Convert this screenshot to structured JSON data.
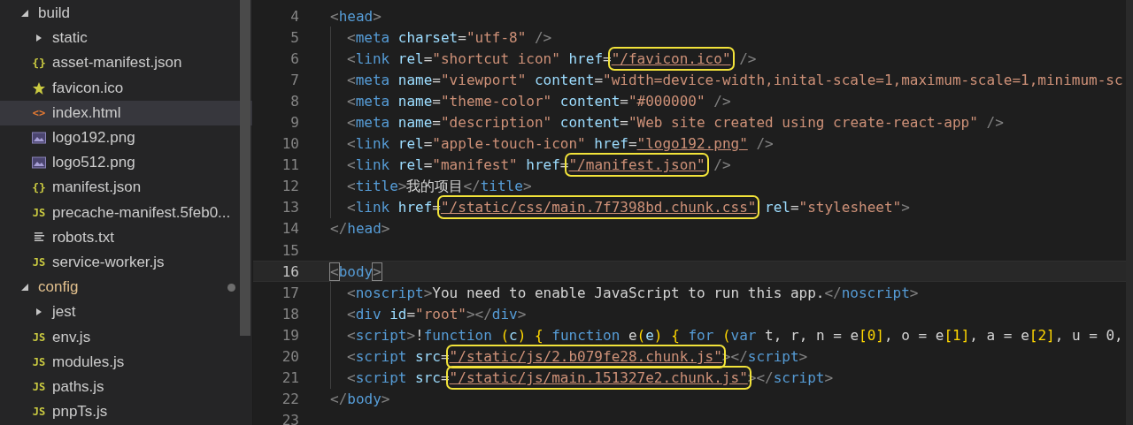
{
  "sidebar": {
    "items": [
      {
        "kind": "folder",
        "label": "build",
        "expanded": true,
        "modified": false,
        "selected": false,
        "children": [
          {
            "kind": "folder",
            "label": "static",
            "expanded": false,
            "modified": false,
            "selected": false
          },
          {
            "kind": "json",
            "glyph": "{}",
            "label": "asset-manifest.json",
            "selected": false
          },
          {
            "kind": "star",
            "label": "favicon.ico",
            "selected": false
          },
          {
            "kind": "html",
            "glyph": "<>",
            "label": "index.html",
            "selected": true
          },
          {
            "kind": "image",
            "label": "logo192.png",
            "selected": false
          },
          {
            "kind": "image",
            "label": "logo512.png",
            "selected": false
          },
          {
            "kind": "json",
            "glyph": "{}",
            "label": "manifest.json",
            "selected": false
          },
          {
            "kind": "js",
            "glyph": "JS",
            "label": "precache-manifest.5feb0...",
            "selected": false
          },
          {
            "kind": "text",
            "label": "robots.txt",
            "selected": false
          },
          {
            "kind": "js",
            "glyph": "JS",
            "label": "service-worker.js",
            "selected": false
          }
        ]
      },
      {
        "kind": "folder",
        "label": "config",
        "expanded": true,
        "modified": true,
        "selected": false,
        "children": [
          {
            "kind": "folder",
            "label": "jest",
            "expanded": false,
            "modified": false,
            "selected": false
          },
          {
            "kind": "js",
            "glyph": "JS",
            "label": "env.js",
            "selected": false
          },
          {
            "kind": "js",
            "glyph": "JS",
            "label": "modules.js",
            "selected": false
          },
          {
            "kind": "js",
            "glyph": "JS",
            "label": "paths.js",
            "selected": false
          },
          {
            "kind": "js",
            "glyph": "JS",
            "label": "pnpTs.js",
            "selected": false
          }
        ]
      }
    ]
  },
  "editor": {
    "lines": [
      {
        "number": "4",
        "current": false,
        "tokens": [
          {
            "kind": "p",
            "text": "<"
          },
          {
            "kind": "tag",
            "text": "head"
          },
          {
            "kind": "p",
            "text": ">"
          }
        ],
        "children": [
          {
            "number": "5",
            "current": false,
            "tokens": [
              {
                "kind": "p",
                "text": "<"
              },
              {
                "kind": "tag",
                "text": "meta"
              },
              {
                "kind": "attr",
                "text": " charset"
              },
              {
                "kind": "txt",
                "text": "="
              },
              {
                "kind": "str",
                "text": "\"utf-8\""
              },
              {
                "kind": "p",
                "text": " />"
              }
            ]
          },
          {
            "number": "6",
            "current": false,
            "tokens": [
              {
                "kind": "p",
                "text": "<"
              },
              {
                "kind": "tag",
                "text": "link"
              },
              {
                "kind": "attr",
                "text": " rel"
              },
              {
                "kind": "txt",
                "text": "="
              },
              {
                "kind": "str",
                "text": "\"shortcut icon\""
              },
              {
                "kind": "attr",
                "text": " href"
              },
              {
                "kind": "txt",
                "text": "="
              },
              {
                "kind": "str",
                "text": "\"/favicon.ico\"",
                "boxed": true,
                "link": true
              },
              {
                "kind": "p",
                "text": " />"
              }
            ]
          },
          {
            "number": "7",
            "current": false,
            "tokens": [
              {
                "kind": "p",
                "text": "<"
              },
              {
                "kind": "tag",
                "text": "meta"
              },
              {
                "kind": "attr",
                "text": " name"
              },
              {
                "kind": "txt",
                "text": "="
              },
              {
                "kind": "str",
                "text": "\"viewport\""
              },
              {
                "kind": "attr",
                "text": " content"
              },
              {
                "kind": "txt",
                "text": "="
              },
              {
                "kind": "str",
                "text": "\"width=device-width,inital-scale=1,maximum-scale=1,minimum-sc"
              }
            ]
          },
          {
            "number": "8",
            "current": false,
            "tokens": [
              {
                "kind": "p",
                "text": "<"
              },
              {
                "kind": "tag",
                "text": "meta"
              },
              {
                "kind": "attr",
                "text": " name"
              },
              {
                "kind": "txt",
                "text": "="
              },
              {
                "kind": "str",
                "text": "\"theme-color\""
              },
              {
                "kind": "attr",
                "text": " content"
              },
              {
                "kind": "txt",
                "text": "="
              },
              {
                "kind": "str",
                "text": "\"#000000\""
              },
              {
                "kind": "p",
                "text": " />"
              }
            ]
          },
          {
            "number": "9",
            "current": false,
            "tokens": [
              {
                "kind": "p",
                "text": "<"
              },
              {
                "kind": "tag",
                "text": "meta"
              },
              {
                "kind": "attr",
                "text": " name"
              },
              {
                "kind": "txt",
                "text": "="
              },
              {
                "kind": "str",
                "text": "\"description\""
              },
              {
                "kind": "attr",
                "text": " content"
              },
              {
                "kind": "txt",
                "text": "="
              },
              {
                "kind": "str",
                "text": "\"Web site created using create-react-app\""
              },
              {
                "kind": "p",
                "text": " />"
              }
            ]
          },
          {
            "number": "10",
            "current": false,
            "tokens": [
              {
                "kind": "p",
                "text": "<"
              },
              {
                "kind": "tag",
                "text": "link"
              },
              {
                "kind": "attr",
                "text": " rel"
              },
              {
                "kind": "txt",
                "text": "="
              },
              {
                "kind": "str",
                "text": "\"apple-touch-icon\""
              },
              {
                "kind": "attr",
                "text": " href"
              },
              {
                "kind": "txt",
                "text": "="
              },
              {
                "kind": "str",
                "text": "\"logo192.png\"",
                "link": true
              },
              {
                "kind": "p",
                "text": " />"
              }
            ]
          },
          {
            "number": "11",
            "current": false,
            "tokens": [
              {
                "kind": "p",
                "text": "<"
              },
              {
                "kind": "tag",
                "text": "link"
              },
              {
                "kind": "attr",
                "text": " rel"
              },
              {
                "kind": "txt",
                "text": "="
              },
              {
                "kind": "str",
                "text": "\"manifest\""
              },
              {
                "kind": "attr",
                "text": " href"
              },
              {
                "kind": "txt",
                "text": "="
              },
              {
                "kind": "str",
                "text": "\"/manifest.json\"",
                "boxed": true,
                "link": true
              },
              {
                "kind": "p",
                "text": " />"
              }
            ]
          },
          {
            "number": "12",
            "current": false,
            "tokens": [
              {
                "kind": "p",
                "text": "<"
              },
              {
                "kind": "tag",
                "text": "title"
              },
              {
                "kind": "p",
                "text": ">"
              },
              {
                "kind": "txt",
                "text": "我的项目"
              },
              {
                "kind": "p",
                "text": "</"
              },
              {
                "kind": "tag",
                "text": "title"
              },
              {
                "kind": "p",
                "text": ">"
              }
            ]
          },
          {
            "number": "13",
            "current": false,
            "tokens": [
              {
                "kind": "p",
                "text": "<"
              },
              {
                "kind": "tag",
                "text": "link"
              },
              {
                "kind": "attr",
                "text": " href"
              },
              {
                "kind": "txt",
                "text": "="
              },
              {
                "kind": "str",
                "text": "\"/static/css/main.7f7398bd.chunk.css\"",
                "boxed": true,
                "link": true
              },
              {
                "kind": "attr",
                "text": " rel"
              },
              {
                "kind": "txt",
                "text": "="
              },
              {
                "kind": "str",
                "text": "\"stylesheet\""
              },
              {
                "kind": "p",
                "text": ">"
              }
            ]
          }
        ]
      },
      {
        "number": "14",
        "current": false,
        "tokens": [
          {
            "kind": "p",
            "text": "</"
          },
          {
            "kind": "tag",
            "text": "head"
          },
          {
            "kind": "p",
            "text": ">"
          }
        ]
      },
      {
        "number": "15",
        "current": false
      },
      {
        "number": "16",
        "current": true,
        "tokens": [
          {
            "kind": "p",
            "text": "<",
            "match": true
          },
          {
            "kind": "tag",
            "text": "body"
          },
          {
            "kind": "p",
            "text": ">",
            "match": true
          }
        ],
        "children": [
          {
            "number": "17",
            "current": false,
            "tokens": [
              {
                "kind": "p",
                "text": "<"
              },
              {
                "kind": "tag",
                "text": "noscript"
              },
              {
                "kind": "p",
                "text": ">"
              },
              {
                "kind": "txt",
                "text": "You need to enable JavaScript to run this app."
              },
              {
                "kind": "p",
                "text": "</"
              },
              {
                "kind": "tag",
                "text": "noscript"
              },
              {
                "kind": "p",
                "text": ">"
              }
            ]
          },
          {
            "number": "18",
            "current": false,
            "tokens": [
              {
                "kind": "p",
                "text": "<"
              },
              {
                "kind": "tag",
                "text": "div"
              },
              {
                "kind": "attr",
                "text": " id"
              },
              {
                "kind": "txt",
                "text": "="
              },
              {
                "kind": "str",
                "text": "\"root\""
              },
              {
                "kind": "p",
                "text": "></"
              },
              {
                "kind": "tag",
                "text": "div"
              },
              {
                "kind": "p",
                "text": ">"
              }
            ]
          },
          {
            "number": "19",
            "current": false,
            "tokens": [
              {
                "kind": "p",
                "text": "<"
              },
              {
                "kind": "tag",
                "text": "script"
              },
              {
                "kind": "p",
                "text": ">"
              },
              {
                "kind": "txt",
                "text": "!"
              },
              {
                "kind": "kw",
                "text": "function "
              },
              {
                "kind": "br",
                "text": "("
              },
              {
                "kind": "attr",
                "text": "c"
              },
              {
                "kind": "br",
                "text": ") {"
              },
              {
                "kind": "kw",
                "text": " function "
              },
              {
                "kind": "txt",
                "text": "e"
              },
              {
                "kind": "br",
                "text": "("
              },
              {
                "kind": "attr",
                "text": "e"
              },
              {
                "kind": "br",
                "text": ") {"
              },
              {
                "kind": "kw",
                "text": " for "
              },
              {
                "kind": "br",
                "text": "("
              },
              {
                "kind": "kw",
                "text": "var"
              },
              {
                "kind": "txt",
                "text": " t, r, n = e"
              },
              {
                "kind": "br",
                "text": "[0]"
              },
              {
                "kind": "txt",
                "text": ", o = e"
              },
              {
                "kind": "br",
                "text": "[1]"
              },
              {
                "kind": "txt",
                "text": ", a = e"
              },
              {
                "kind": "br",
                "text": "[2]"
              },
              {
                "kind": "txt",
                "text": ", u = 0,"
              }
            ]
          },
          {
            "number": "20",
            "current": false,
            "tokens": [
              {
                "kind": "p",
                "text": "<"
              },
              {
                "kind": "tag",
                "text": "script"
              },
              {
                "kind": "attr",
                "text": " src"
              },
              {
                "kind": "txt",
                "text": "="
              },
              {
                "kind": "str",
                "text": "\"/static/js/2.b079fe28.chunk.js\"",
                "boxed": true,
                "link": true
              },
              {
                "kind": "p",
                "text": "></"
              },
              {
                "kind": "tag",
                "text": "script"
              },
              {
                "kind": "p",
                "text": ">"
              }
            ]
          },
          {
            "number": "21",
            "current": false,
            "tokens": [
              {
                "kind": "p",
                "text": "<"
              },
              {
                "kind": "tag",
                "text": "script"
              },
              {
                "kind": "attr",
                "text": " src"
              },
              {
                "kind": "txt",
                "text": "="
              },
              {
                "kind": "str",
                "text": "\"/static/js/main.151327e2.chunk.js\"",
                "boxed": true,
                "link": true
              },
              {
                "kind": "p",
                "text": "></"
              },
              {
                "kind": "tag",
                "text": "script"
              },
              {
                "kind": "p",
                "text": ">"
              }
            ]
          }
        ]
      },
      {
        "number": "22",
        "current": false,
        "tokens": [
          {
            "kind": "p",
            "text": "</"
          },
          {
            "kind": "tag",
            "text": "body"
          },
          {
            "kind": "p",
            "text": ">"
          }
        ]
      },
      {
        "number": "23",
        "current": false
      }
    ]
  }
}
